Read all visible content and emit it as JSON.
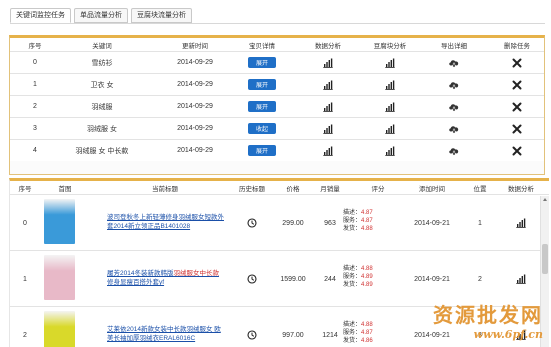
{
  "tabs": [
    {
      "label": "关键词监控任务",
      "active": true
    },
    {
      "label": "单品流量分析",
      "active": false
    },
    {
      "label": "豆腐块流量分析",
      "active": false
    }
  ],
  "keyword_table": {
    "headers": [
      "序号",
      "关键词",
      "更新时间",
      "宝贝详情",
      "数据分析",
      "豆腐块分析",
      "导出详细",
      "删除任务"
    ],
    "rows": [
      {
        "index": "0",
        "keyword": "雪纺衫",
        "updated": "2014-09-29",
        "detail_btn": "展开"
      },
      {
        "index": "1",
        "keyword": "卫衣 女",
        "updated": "2014-09-29",
        "detail_btn": "展开"
      },
      {
        "index": "2",
        "keyword": "羽绒服",
        "updated": "2014-09-29",
        "detail_btn": "展开"
      },
      {
        "index": "3",
        "keyword": "羽绒服 女",
        "updated": "2014-09-29",
        "detail_btn": "收起"
      },
      {
        "index": "4",
        "keyword": "羽绒服 女 中长款",
        "updated": "2014-09-29",
        "detail_btn": "展开"
      }
    ],
    "icons": {
      "analysis": "bar-chart-icon",
      "tofu": "bar-chart-icon",
      "export": "cloud-download-icon",
      "delete": "close-icon"
    }
  },
  "item_table": {
    "headers": [
      "序号",
      "首图",
      "当前标题",
      "历史标题",
      "价格",
      "月销量",
      "评分",
      "添加时间",
      "位置",
      "数据分析"
    ],
    "score_labels": [
      "描述：",
      "服务：",
      "发货："
    ],
    "rows": [
      {
        "index": "0",
        "title_pre": "波司登秋冬上新轻薄修身羽绒服女短款外套2014新立领正品B1401028",
        "title_hl": "",
        "title_post": "",
        "price": "299.00",
        "monthly_sales": "963",
        "scores": [
          "4.87",
          "4.87",
          "4.88"
        ],
        "added": "2014-09-21",
        "position": "1"
      },
      {
        "index": "1",
        "title_pre": "履芳2014冬装新款韩版",
        "title_hl": "羽绒服女中长款",
        "title_post": "修身显瘦百搭外套yf",
        "price": "1599.00",
        "monthly_sales": "244",
        "scores": [
          "4.88",
          "4.89",
          "4.89"
        ],
        "added": "2014-09-21",
        "position": "2"
      },
      {
        "index": "2",
        "title_pre": "艾莱依2014新款女装中长款羽绒服女 欧美长袖加厚羽绒衣ERAL6016C",
        "title_hl": "",
        "title_post": "",
        "price": "997.00",
        "monthly_sales": "1214",
        "scores": [
          "4.88",
          "4.87",
          "4.86"
        ],
        "added": "2014-09-21",
        "position": "3"
      }
    ],
    "thumb_colors": [
      "#3a9ad9",
      "#e8b9c8",
      "#d9d92a"
    ]
  },
  "watermark": {
    "line1": "资源批发网",
    "line2": "www.6pf.cn"
  },
  "colors": {
    "accent_bar": "#e6b24a",
    "button": "#1f6fc7",
    "link": "#1a4fa8",
    "score": "#d03030"
  }
}
